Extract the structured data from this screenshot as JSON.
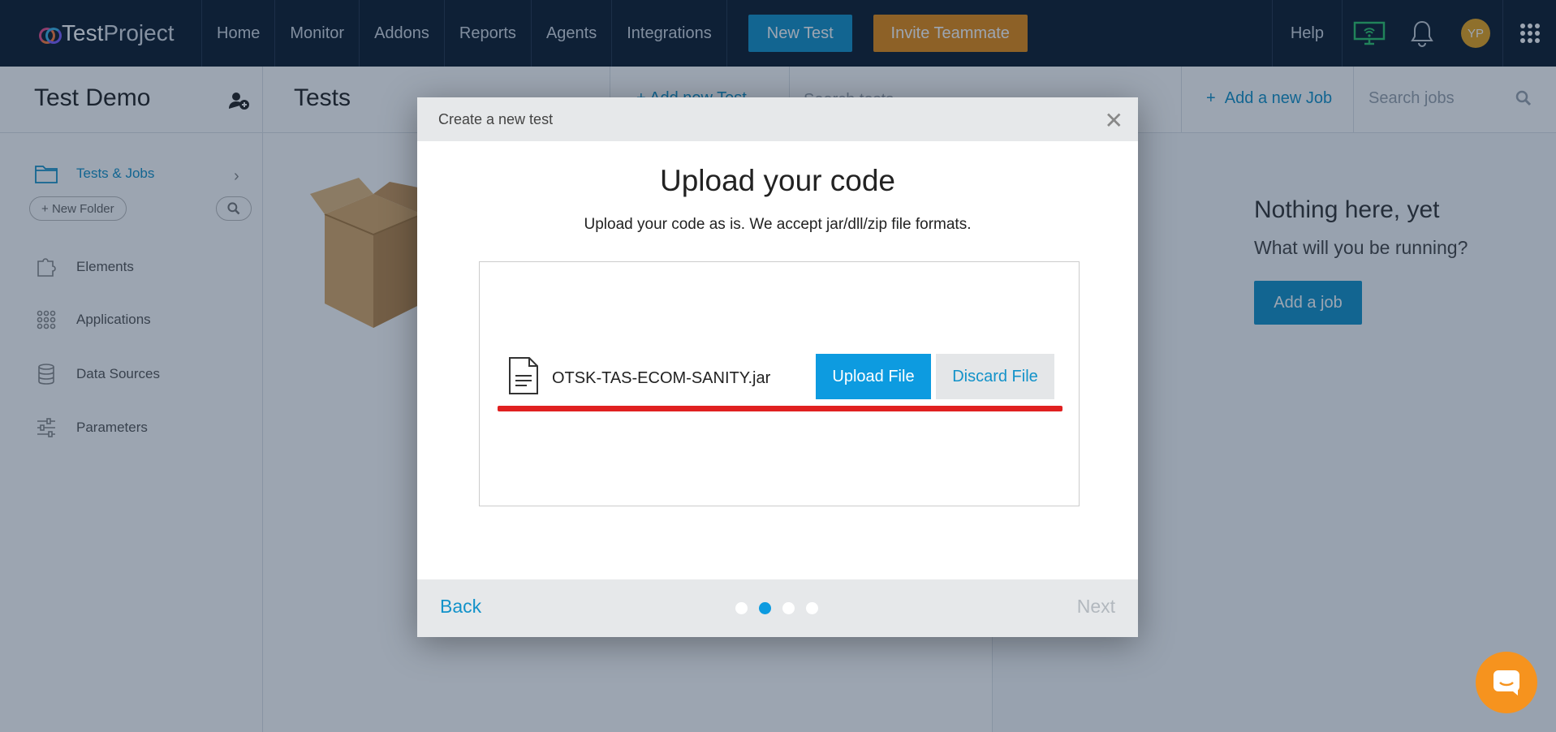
{
  "brand": {
    "logo_bold": "Test",
    "logo_light": "Project"
  },
  "nav": {
    "items": [
      "Home",
      "Monitor",
      "Addons",
      "Reports",
      "Agents",
      "Integrations"
    ],
    "new_test": "New Test",
    "invite": "Invite Teammate",
    "help": "Help",
    "avatar_initials": "YP"
  },
  "project": {
    "title": "Test Demo"
  },
  "tests_panel": {
    "title": "Tests",
    "add_label": "+ Add new Test",
    "search_placeholder": "Search tests"
  },
  "jobs_panel": {
    "add_label": "Add a new Job",
    "search_placeholder": "Search jobs",
    "empty_title": "Nothing here, yet",
    "empty_sub": "What will you be running?",
    "add_button": "Add a job"
  },
  "sidebar": {
    "tests_jobs": "Tests & Jobs",
    "new_folder": "New Folder",
    "items": [
      "Elements",
      "Applications",
      "Data Sources",
      "Parameters"
    ]
  },
  "modal": {
    "header": "Create a new test",
    "title": "Upload your code",
    "subtitle": "Upload your code as is. We accept jar/dll/zip file formats.",
    "filename": "OTSK-TAS-ECOM-SANITY.jar",
    "upload_button": "Upload File",
    "discard_button": "Discard File",
    "back": "Back",
    "next": "Next",
    "step_total": 4,
    "step_active": 2
  },
  "colors": {
    "accent": "#1292c9",
    "invite": "#e58a12",
    "topbar": "#0b1a2c",
    "highlight": "#e02020",
    "chat": "#f6931e"
  }
}
